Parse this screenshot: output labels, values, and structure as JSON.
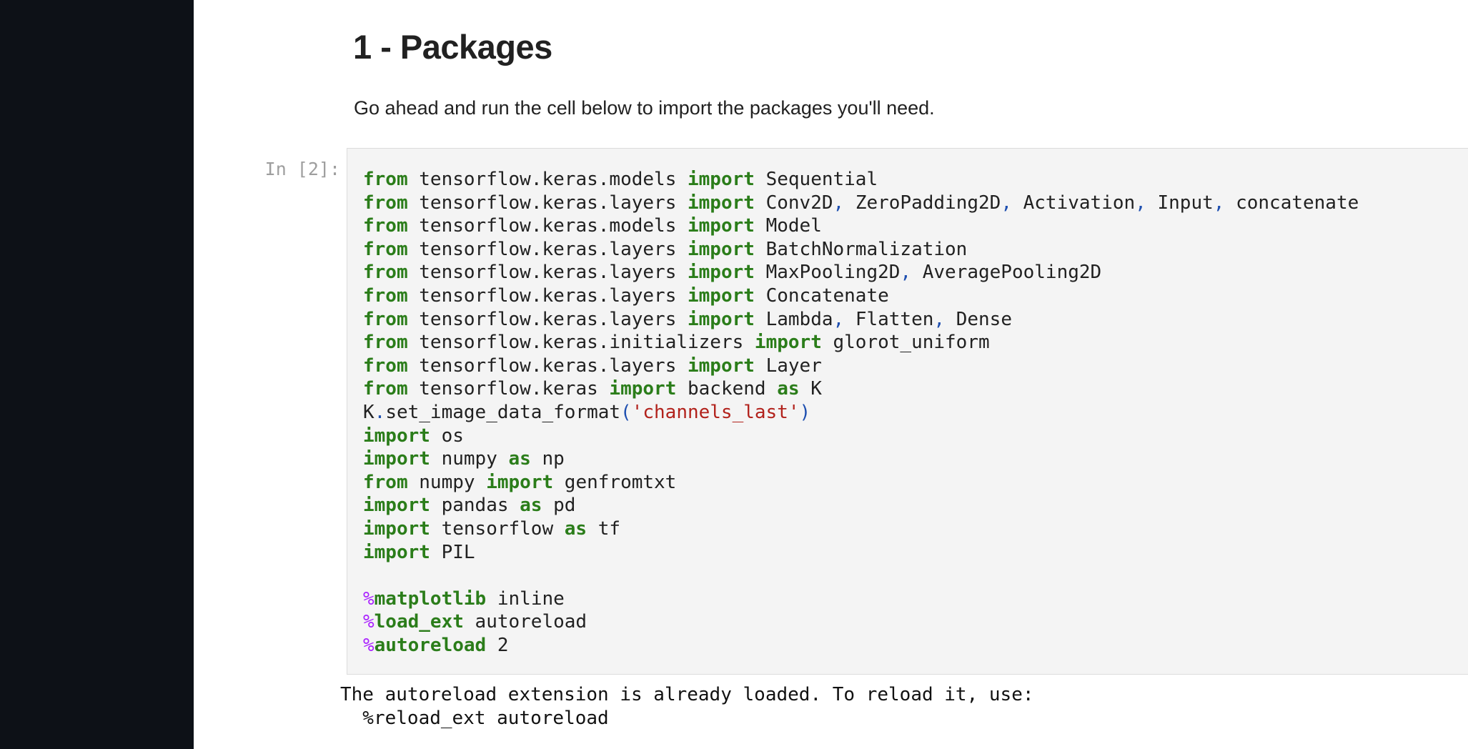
{
  "section": {
    "heading": "1 - Packages",
    "intro": "Go ahead and run the cell below to import the packages you'll need."
  },
  "cell": {
    "prompt": "In [2]:",
    "code_lines": [
      "from tensorflow.keras.models import Sequential",
      "from tensorflow.keras.layers import Conv2D, ZeroPadding2D, Activation, Input, concatenate",
      "from tensorflow.keras.models import Model",
      "from tensorflow.keras.layers import BatchNormalization",
      "from tensorflow.keras.layers import MaxPooling2D, AveragePooling2D",
      "from tensorflow.keras.layers import Concatenate",
      "from tensorflow.keras.layers import Lambda, Flatten, Dense",
      "from tensorflow.keras.initializers import glorot_uniform",
      "from tensorflow.keras.layers import Layer",
      "from tensorflow.keras import backend as K",
      "K.set_image_data_format('channels_last')",
      "import os",
      "import numpy as np",
      "from numpy import genfromtxt",
      "import pandas as pd",
      "import tensorflow as tf",
      "import PIL",
      "",
      "%matplotlib inline",
      "%load_ext autoreload",
      "%autoreload 2"
    ],
    "output_lines": [
      "The autoreload extension is already loaded. To reload it, use:",
      "  %reload_ext autoreload"
    ]
  },
  "theme": {
    "sidebar_bg": "#0d1117",
    "cell_bg": "#f4f4f4",
    "keyword_color": "#2b7d1a",
    "punctuation_color": "#1e4fb0",
    "string_color": "#b2221c",
    "magic_color": "#aa22ff"
  }
}
